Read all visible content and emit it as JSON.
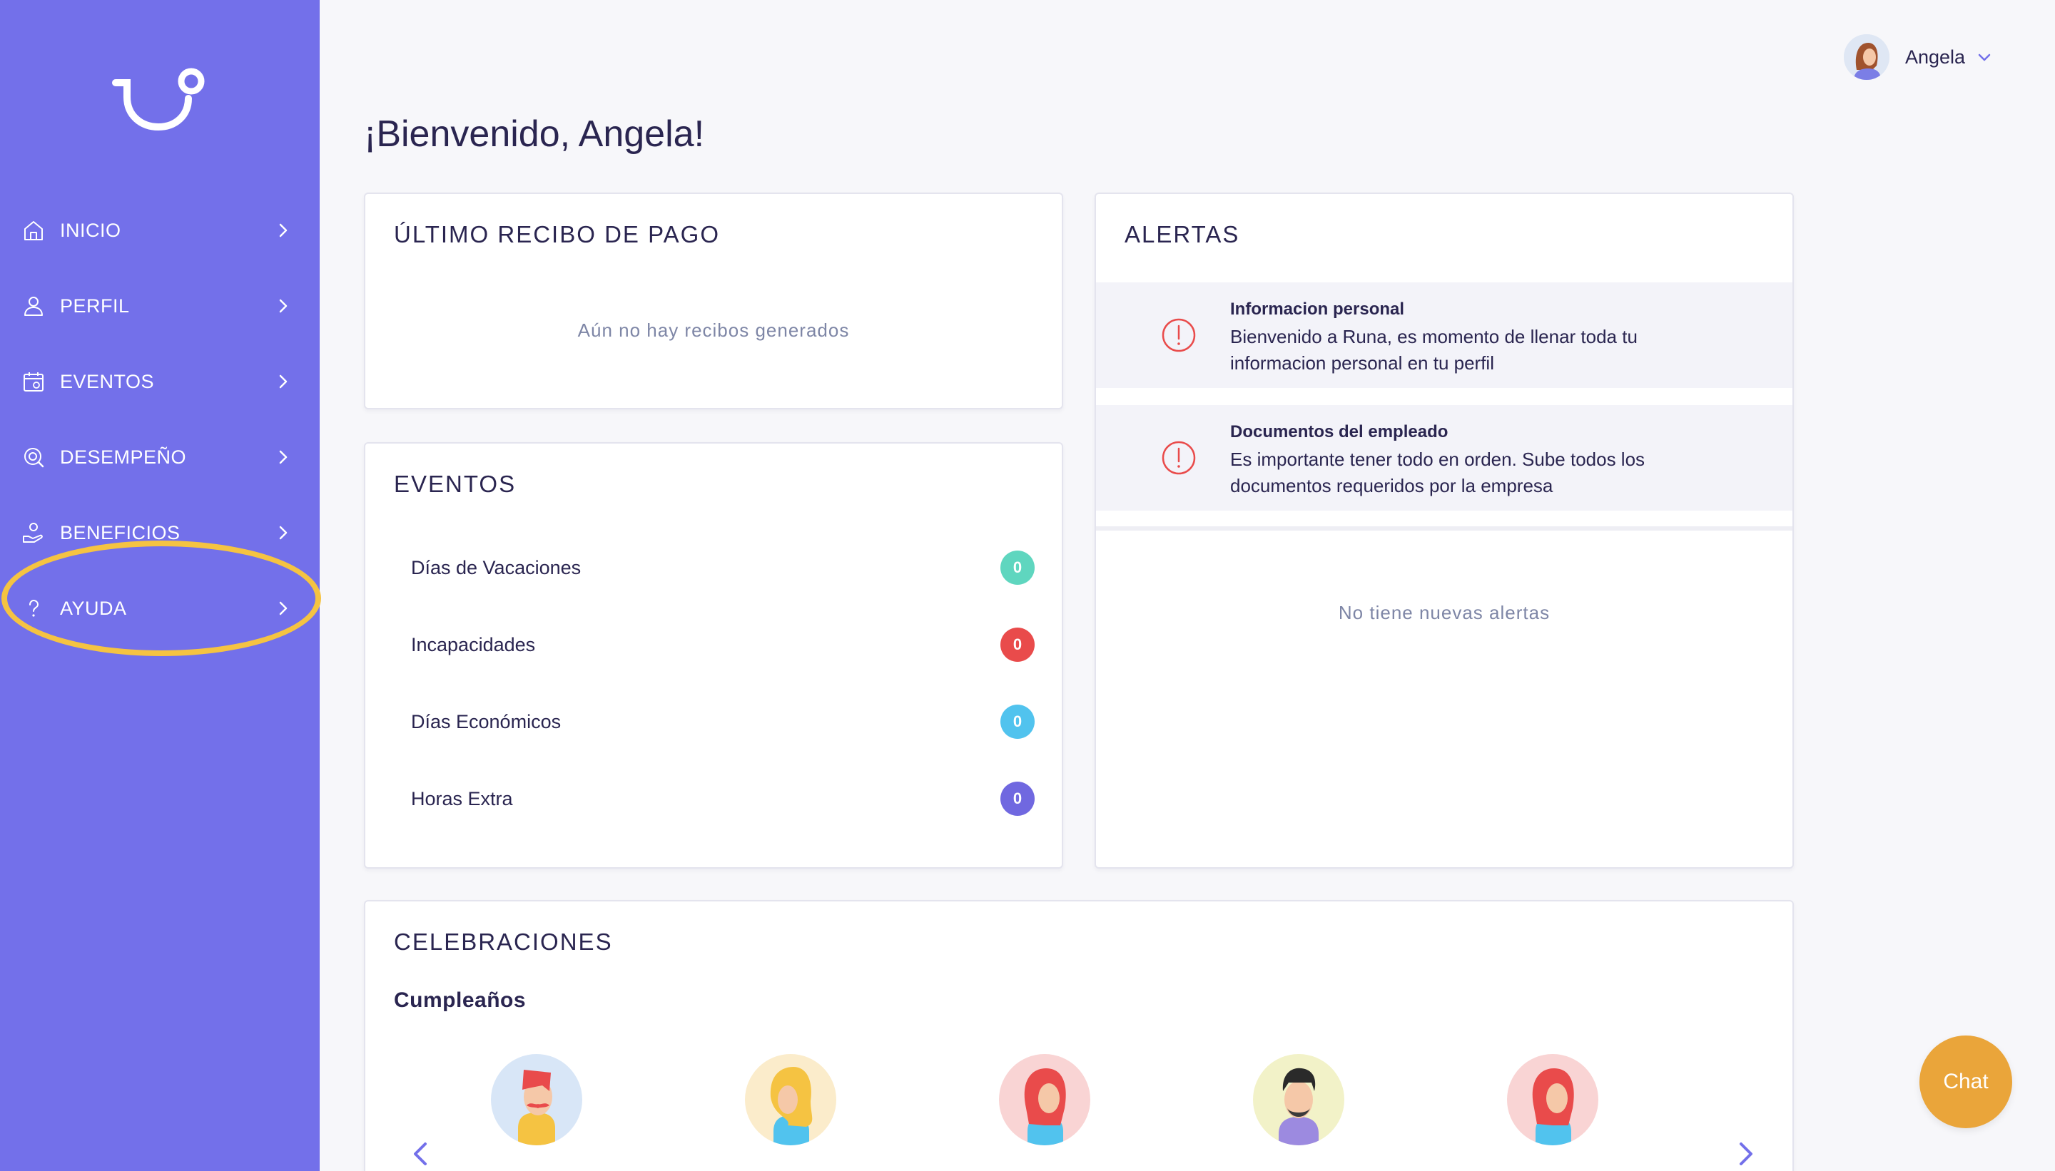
{
  "sidebar": {
    "items": [
      {
        "label": "INICIO",
        "icon": "home-icon"
      },
      {
        "label": "PERFIL",
        "icon": "user-icon"
      },
      {
        "label": "EVENTOS",
        "icon": "calendar-icon"
      },
      {
        "label": "DESEMPEÑO",
        "icon": "performance-icon"
      },
      {
        "label": "BENEFICIOS",
        "icon": "benefits-icon"
      },
      {
        "label": "AYUDA",
        "icon": "help-icon"
      }
    ],
    "highlighted_item": "AYUDA",
    "highlight_color": "#f5c342",
    "background": "#7370ea"
  },
  "header": {
    "user_name": "Angela",
    "welcome": "¡Bienvenido, Angela!"
  },
  "receipt": {
    "title": "ÚLTIMO RECIBO DE PAGO",
    "empty": "Aún no hay recibos generados"
  },
  "events": {
    "title": "EVENTOS",
    "rows": [
      {
        "label": "Días de Vacaciones",
        "count": "0",
        "color": "#5fd6bf"
      },
      {
        "label": "Incapacidades",
        "count": "0",
        "color": "#e94b4b"
      },
      {
        "label": "Días Económicos",
        "count": "0",
        "color": "#51c3ee"
      },
      {
        "label": "Horas Extra",
        "count": "0",
        "color": "#7068e0"
      }
    ]
  },
  "alerts": {
    "title": "ALERTAS",
    "items": [
      {
        "title": "Informacion personal",
        "text": "Bienvenido a Runa, es momento de llenar toda tu informacion personal en tu perfil"
      },
      {
        "title": "Documentos del empleado",
        "text": "Es importante tener todo en orden. Sube todos los documentos requeridos por la empresa"
      }
    ],
    "empty": "No tiene nuevas alertas",
    "icon_color": "#e94b4b"
  },
  "celebrations": {
    "title": "CELEBRACIONES",
    "subtitle": "Cumpleaños"
  },
  "chat": {
    "label": "Chat",
    "color": "#eaa53a"
  }
}
